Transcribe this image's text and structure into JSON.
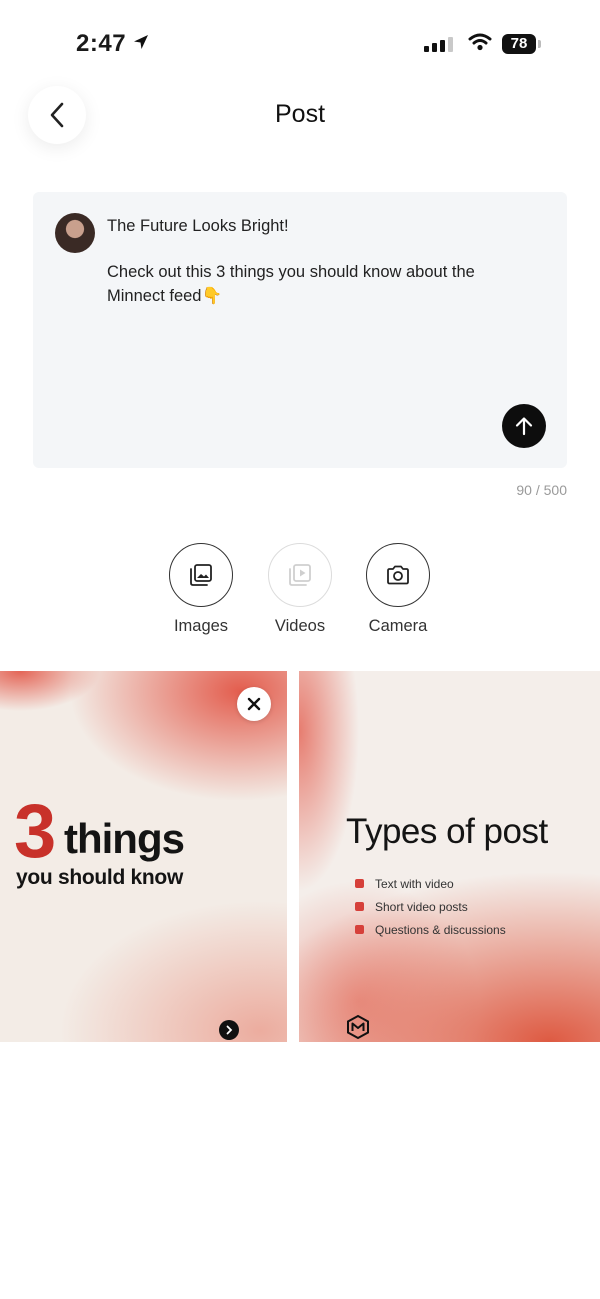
{
  "status_bar": {
    "time": "2:47",
    "battery": "78"
  },
  "header": {
    "title": "Post"
  },
  "composer": {
    "line1": "The Future Looks Bright!",
    "line2": "Check out this 3 things you should know about the Minnect feed👇",
    "char_count": "90 / 500"
  },
  "media_options": [
    {
      "label": "Images",
      "icon": "images-icon",
      "enabled": true
    },
    {
      "label": "Videos",
      "icon": "videos-icon",
      "enabled": false
    },
    {
      "label": "Camera",
      "icon": "camera-icon",
      "enabled": true
    }
  ],
  "attachments": [
    {
      "big_number": "3",
      "headline": "things",
      "subline": "you should know"
    },
    {
      "headline": "Types of post",
      "items": [
        "Text with video",
        "Short video posts",
        "Questions & discussions"
      ]
    }
  ],
  "colors": {
    "accent_red": "#c8312a",
    "send_button": "#0d0d0d",
    "composer_bg": "#f4f6f8"
  }
}
